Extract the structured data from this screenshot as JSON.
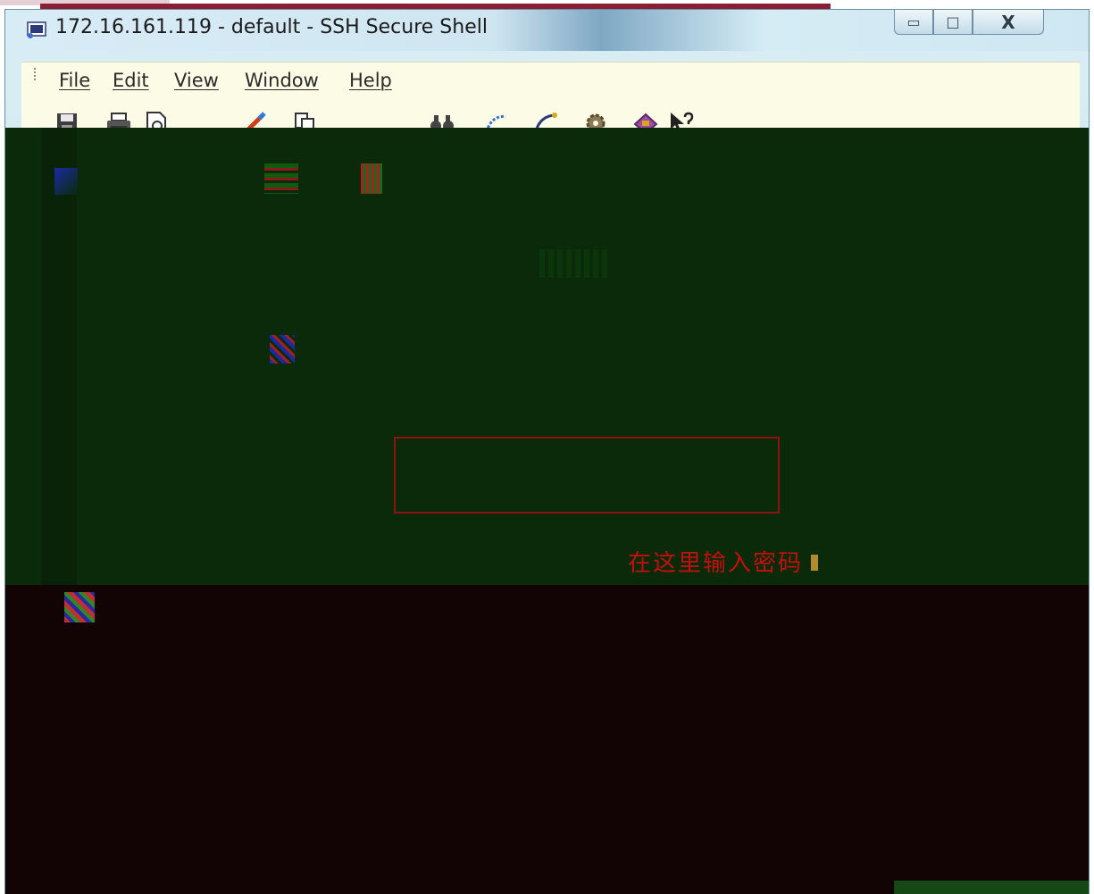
{
  "window": {
    "title": "172.16.161.119 - default - SSH Secure Shell",
    "controls": {
      "minimize": "▭",
      "maximize": "□",
      "close": "X"
    }
  },
  "menu": {
    "items": [
      "File",
      "Edit",
      "View",
      "Window",
      "Help"
    ]
  },
  "toolbar": {
    "icons": [
      "save-icon",
      "print-icon",
      "print-preview-icon",
      "edit-icon",
      "copy-icon",
      "find-icon",
      "connect-icon",
      "disconnect-icon",
      "settings-icon",
      "profiles-icon",
      "help-icon"
    ]
  },
  "terminal": {
    "annotation_hint": "在这里输入密码"
  },
  "colors": {
    "terminal_bg": "#0a2a0a",
    "terminal_lower_bg": "#120404",
    "highlight_box": "#8f1111",
    "hint_text": "#c40f0f",
    "menu_bg": "#fbfbe6"
  }
}
